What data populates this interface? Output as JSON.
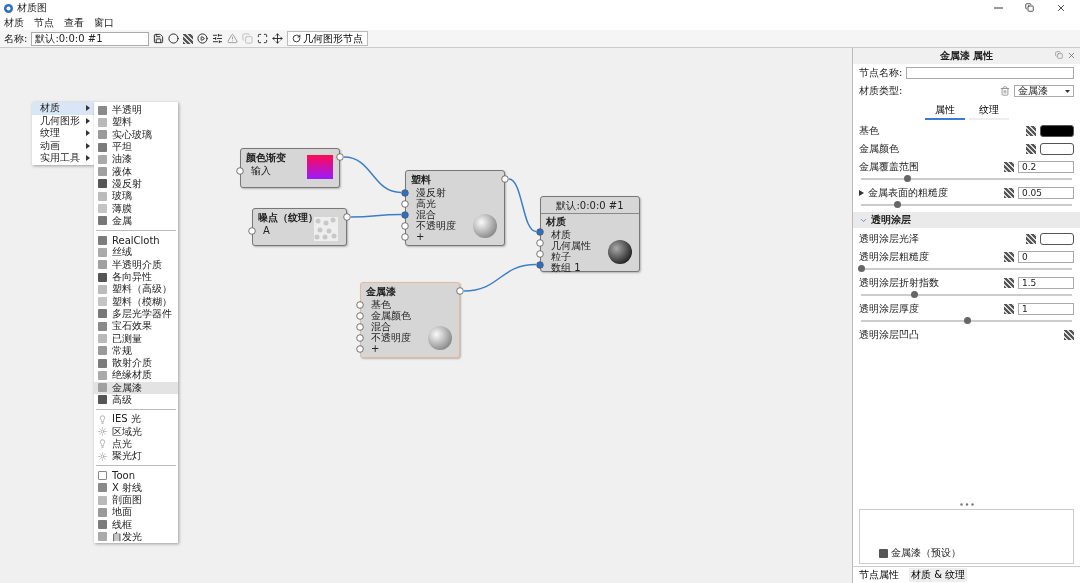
{
  "window": {
    "title": "材质图"
  },
  "menu": [
    "材质",
    "节点",
    "查看",
    "窗口"
  ],
  "toolbar": {
    "name_label": "名称:",
    "name_value": "默认:0:0:0 #1",
    "geometry_button": "几何图形节点"
  },
  "context_menu": {
    "items": [
      {
        "label": "材质",
        "selected": true
      },
      {
        "label": "几何图形",
        "selected": false
      },
      {
        "label": "纹理",
        "selected": false
      },
      {
        "label": "动画",
        "selected": false
      },
      {
        "label": "实用工具",
        "selected": false
      }
    ],
    "submenu": [
      {
        "group": [
          {
            "label": "半透明",
            "selected": false
          },
          {
            "label": "塑料",
            "selected": false
          },
          {
            "label": "实心玻璃",
            "selected": false
          },
          {
            "label": "平坦",
            "selected": false
          },
          {
            "label": "油漆",
            "selected": false
          },
          {
            "label": "液体",
            "selected": false
          },
          {
            "label": "漫反射",
            "selected": false
          },
          {
            "label": "玻璃",
            "selected": false
          },
          {
            "label": "薄膜",
            "selected": false
          },
          {
            "label": "金属",
            "selected": false
          }
        ]
      },
      {
        "group": [
          {
            "label": "RealCloth",
            "selected": false
          },
          {
            "label": "丝绒",
            "selected": false
          },
          {
            "label": "半透明介质",
            "selected": false
          },
          {
            "label": "各向异性",
            "selected": false
          },
          {
            "label": "塑料（高级）",
            "selected": false
          },
          {
            "label": "塑料（模糊）",
            "selected": false
          },
          {
            "label": "多层光学器件",
            "selected": false
          },
          {
            "label": "宝石效果",
            "selected": false
          },
          {
            "label": "已测量",
            "selected": false
          },
          {
            "label": "常规",
            "selected": false
          },
          {
            "label": "散射介质",
            "selected": false
          },
          {
            "label": "绝缘材质",
            "selected": false
          },
          {
            "label": "金属漆",
            "selected": true
          },
          {
            "label": "高级",
            "selected": false
          }
        ]
      },
      {
        "group": [
          {
            "label": "IES 光",
            "selected": false
          },
          {
            "label": "区域光",
            "selected": false
          },
          {
            "label": "点光",
            "selected": false
          },
          {
            "label": "聚光灯",
            "selected": false
          }
        ]
      },
      {
        "group": [
          {
            "label": "Toon",
            "selected": false
          },
          {
            "label": "X 射线",
            "selected": false
          },
          {
            "label": "剖面图",
            "selected": false
          },
          {
            "label": "地面",
            "selected": false
          },
          {
            "label": "线框",
            "selected": false
          },
          {
            "label": "自发光",
            "selected": false
          }
        ]
      }
    ]
  },
  "nodes": [
    {
      "kind": "gradient",
      "title": "颜色渐变",
      "selected": false,
      "inputs": [
        {
          "label": "输入",
          "connected": false
        }
      ]
    },
    {
      "kind": "noise",
      "title": "噪点（纹理）",
      "selected": false,
      "inputs": [
        {
          "label": "A",
          "connected": false
        }
      ]
    },
    {
      "kind": "material",
      "title": "塑料",
      "selected": false,
      "inputs": [
        {
          "label": "漫反射",
          "connected": true
        },
        {
          "label": "高光",
          "connected": false
        },
        {
          "label": "混合",
          "connected": true
        },
        {
          "label": "不透明度",
          "connected": false
        },
        {
          "label": "+",
          "connected": false
        }
      ]
    },
    {
      "kind": "output",
      "header": "默认:0:0:0 #1",
      "title": "材质",
      "selected": false,
      "inputs": [
        {
          "label": "材质",
          "connected": true
        },
        {
          "label": "几何属性",
          "connected": false
        },
        {
          "label": "粒子",
          "connected": false
        },
        {
          "label": "数组 1",
          "connected": true
        }
      ]
    },
    {
      "kind": "material",
      "title": "金属漆",
      "selected": true,
      "inputs": [
        {
          "label": "基色",
          "connected": false
        },
        {
          "label": "金属颜色",
          "connected": false
        },
        {
          "label": "混合",
          "connected": false
        },
        {
          "label": "不透明度",
          "connected": false
        },
        {
          "label": "+",
          "connected": false
        }
      ]
    }
  ],
  "panel": {
    "title": "金属漆 属性",
    "node_name_label": "节点名称:",
    "type_label": "材质类型:",
    "type_value": "金属漆",
    "tabs": [
      {
        "label": "属性",
        "selected": true
      },
      {
        "label": "纹理",
        "selected": false
      }
    ],
    "rows": [
      {
        "kind": "color",
        "label": "基色",
        "color": "#000000"
      },
      {
        "kind": "color",
        "label": "金属颜色",
        "color": "#ffffff"
      },
      {
        "kind": "slider",
        "label": "金属覆盖范围",
        "value": "0.2",
        "level": 0.22
      },
      {
        "kind": "slider",
        "label": "金属表面的粗糙度",
        "value": "0.05",
        "level": 0.17,
        "expanded": false
      },
      {
        "kind": "section",
        "label": "透明涂层",
        "expanded": true
      },
      {
        "kind": "color",
        "label": "透明涂层光泽",
        "color": "#ffffff"
      },
      {
        "kind": "slider",
        "label": "透明涂层粗糙度",
        "value": "0",
        "level": 0.0
      },
      {
        "kind": "slider",
        "label": "透明涂层折射指数",
        "value": "1.5",
        "level": 0.25
      },
      {
        "kind": "slider",
        "label": "透明涂层厚度",
        "value": "1",
        "level": 0.5
      },
      {
        "kind": "texture",
        "label": "透明涂层凹凸"
      }
    ]
  },
  "library": {
    "items": [
      "金属漆（预设）"
    ]
  },
  "bottom_tabs": [
    {
      "label": "节点属性",
      "selected": true
    },
    {
      "label": "材质 & 纹理",
      "selected": false
    }
  ]
}
